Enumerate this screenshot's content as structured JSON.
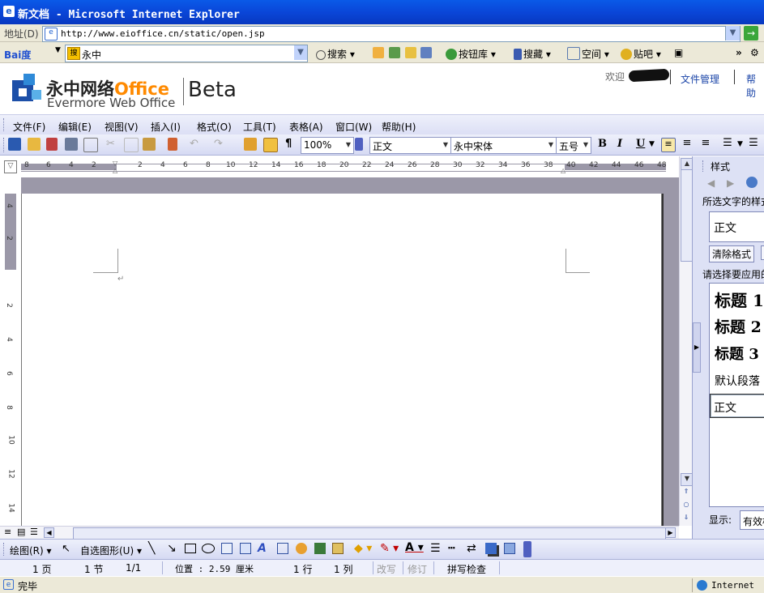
{
  "window": {
    "title": "新文档 - Microsoft Internet Explorer"
  },
  "address": {
    "label": "地址(D)",
    "url": "http://www.eioffice.cn/static/open.jsp"
  },
  "baidu": {
    "logo": "Bai度",
    "logo_small": "百度",
    "query": "永中",
    "buttons": [
      "搜索",
      "按钮库",
      "搜藏",
      "空间",
      "贴吧"
    ]
  },
  "app": {
    "brand_cn": "永中网络",
    "brand_office": "Office",
    "brand_en": "Evermore Web Office",
    "beta": "Beta",
    "welcome": "欢迎",
    "links": [
      "文件管理",
      "帮助"
    ]
  },
  "menu": [
    "文件(F)",
    "编辑(E)",
    "视图(V)",
    "插入(I)",
    "格式(O)",
    "工具(T)",
    "表格(A)",
    "窗口(W)",
    "帮助(H)"
  ],
  "toolbar": {
    "zoom": "100%",
    "style": "正文",
    "font": "永中宋体",
    "size": "五号",
    "bold": "B",
    "italic": "I",
    "underline": "U",
    "pilcrow": "¶"
  },
  "ruler": {
    "h_ticks": [
      "8",
      "6",
      "4",
      "2",
      "2",
      "4",
      "6",
      "8",
      "10",
      "12",
      "14",
      "16",
      "18",
      "20",
      "22",
      "24",
      "26",
      "28",
      "30",
      "32",
      "34",
      "36",
      "38",
      "40",
      "42",
      "44",
      "46",
      "48"
    ],
    "v_ticks": [
      "4",
      "2",
      "2",
      "4",
      "6",
      "8",
      "10",
      "12",
      "14"
    ]
  },
  "pane": {
    "title": "样式",
    "selected_label": "所选文字的样式",
    "current_style": "正文",
    "clear_button": "清除格式",
    "apply_label": "请选择要应用的",
    "styles": [
      "标题 1",
      "标题 2",
      "标题 3",
      "默认段落",
      "正文"
    ],
    "show_label": "显示:",
    "show_value": "有效样"
  },
  "drawbar": {
    "draw": "绘图(R)",
    "autoshape": "自选图形(U)"
  },
  "status": {
    "page": "1 页",
    "section": "1 节",
    "pages": "1/1",
    "position": "位置 : 2.59 厘米",
    "line": "1 行",
    "col": "1 列",
    "ovr": "改写",
    "trk": "修订",
    "spell": "拼写检查"
  },
  "ie_status": {
    "done": "完毕",
    "zone": "Internet"
  }
}
